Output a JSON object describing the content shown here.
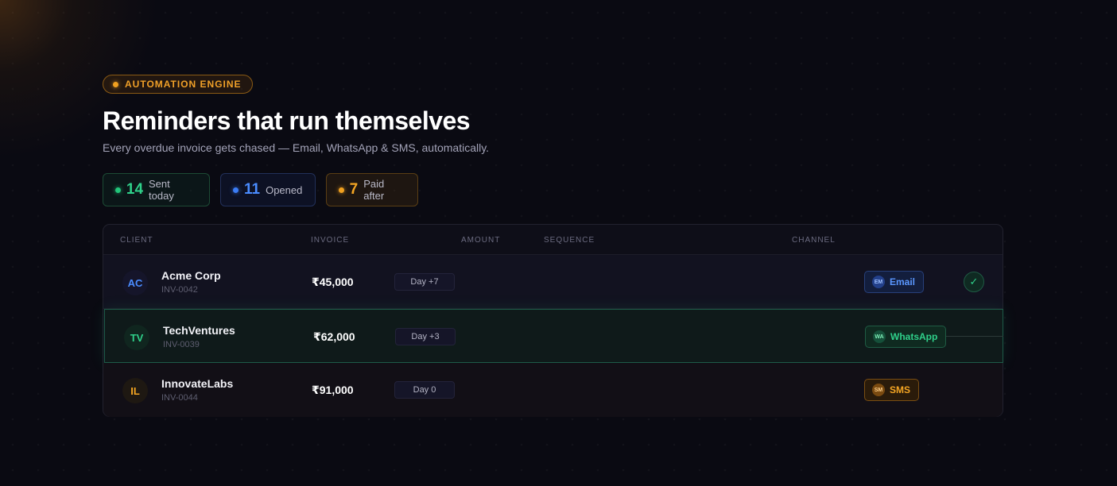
{
  "badge": {
    "label": "AUTOMATION ENGINE"
  },
  "hero": {
    "title": "Reminders that run themselves",
    "subtitle": "Every overdue invoice gets chased — Email, WhatsApp & SMS, automatically."
  },
  "stats": [
    {
      "value": "14",
      "label": "Sent today",
      "color": "#22c57a"
    },
    {
      "value": "11",
      "label": "Opened",
      "color": "#3b7cf5"
    },
    {
      "value": "7",
      "label": "Paid after",
      "color": "#f0a020"
    }
  ],
  "table": {
    "columns": [
      "CLIENT",
      "INVOICE",
      "AMOUNT",
      "SEQUENCE",
      "CHANNEL"
    ],
    "rows": [
      {
        "initials": "AC",
        "client": "Acme Corp",
        "invoice": "INV-0042",
        "amount": "₹45,000",
        "day": "Day +7",
        "channel": "Email",
        "channel_icon": "EM",
        "status": "✓"
      },
      {
        "initials": "TV",
        "client": "TechVentures",
        "invoice": "INV-0039",
        "amount": "₹62,000",
        "day": "Day +3",
        "channel": "WhatsApp",
        "channel_icon": "WA"
      },
      {
        "initials": "IL",
        "client": "InnovateLabs",
        "invoice": "INV-0044",
        "amount": "₹91,000",
        "day": "Day 0",
        "channel": "SMS",
        "channel_icon": "SM"
      }
    ]
  },
  "colors": {
    "accent_amber": "#f0a020",
    "accent_green": "#22c57a",
    "accent_blue": "#3b7cf5",
    "background": "#0a0a12"
  }
}
